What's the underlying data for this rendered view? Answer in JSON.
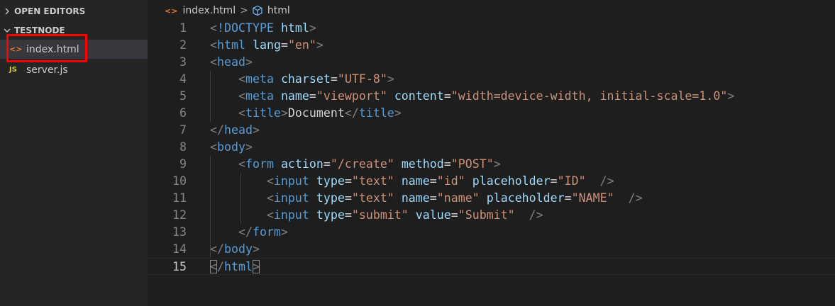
{
  "sidebar": {
    "open_editors_label": "OPEN EDITORS",
    "project_label": "TESTNODE",
    "files": [
      {
        "name": "index.html",
        "icon": "<>",
        "selected": true
      },
      {
        "name": "server.js",
        "icon": "JS",
        "selected": false
      }
    ]
  },
  "breadcrumb": {
    "file": "index.html",
    "separator": ">",
    "symbol": "html"
  },
  "editor": {
    "active_line": 15,
    "lines": [
      {
        "num": "1",
        "tokens": [
          [
            "t-punc",
            "<"
          ],
          [
            "t-tag",
            "!DOCTYPE"
          ],
          [
            "t-text",
            " "
          ],
          [
            "t-attr",
            "html"
          ],
          [
            "t-punc",
            ">"
          ]
        ]
      },
      {
        "num": "2",
        "tokens": [
          [
            "t-punc",
            "<"
          ],
          [
            "t-tag",
            "html"
          ],
          [
            "t-text",
            " "
          ],
          [
            "t-attr",
            "lang"
          ],
          [
            "t-text",
            "="
          ],
          [
            "t-str",
            "\"en\""
          ],
          [
            "t-punc",
            ">"
          ]
        ]
      },
      {
        "num": "3",
        "tokens": [
          [
            "t-punc",
            "<"
          ],
          [
            "t-tag",
            "head"
          ],
          [
            "t-punc",
            ">"
          ]
        ]
      },
      {
        "num": "4",
        "tokens": [
          [
            "t-text",
            "    "
          ],
          [
            "t-punc",
            "<"
          ],
          [
            "t-tag",
            "meta"
          ],
          [
            "t-text",
            " "
          ],
          [
            "t-attr",
            "charset"
          ],
          [
            "t-text",
            "="
          ],
          [
            "t-str",
            "\"UTF-8\""
          ],
          [
            "t-punc",
            ">"
          ]
        ]
      },
      {
        "num": "5",
        "tokens": [
          [
            "t-text",
            "    "
          ],
          [
            "t-punc",
            "<"
          ],
          [
            "t-tag",
            "meta"
          ],
          [
            "t-text",
            " "
          ],
          [
            "t-attr",
            "name"
          ],
          [
            "t-text",
            "="
          ],
          [
            "t-str",
            "\"viewport\""
          ],
          [
            "t-text",
            " "
          ],
          [
            "t-attr",
            "content"
          ],
          [
            "t-text",
            "="
          ],
          [
            "t-str",
            "\"width=device-width, initial-scale=1.0\""
          ],
          [
            "t-punc",
            ">"
          ]
        ]
      },
      {
        "num": "6",
        "tokens": [
          [
            "t-text",
            "    "
          ],
          [
            "t-punc",
            "<"
          ],
          [
            "t-tag",
            "title"
          ],
          [
            "t-punc",
            ">"
          ],
          [
            "t-text",
            "Document"
          ],
          [
            "t-punc",
            "</"
          ],
          [
            "t-tag",
            "title"
          ],
          [
            "t-punc",
            ">"
          ]
        ]
      },
      {
        "num": "7",
        "tokens": [
          [
            "t-punc",
            "</"
          ],
          [
            "t-tag",
            "head"
          ],
          [
            "t-punc",
            ">"
          ]
        ]
      },
      {
        "num": "8",
        "tokens": [
          [
            "t-punc",
            "<"
          ],
          [
            "t-tag",
            "body"
          ],
          [
            "t-punc",
            ">"
          ]
        ]
      },
      {
        "num": "9",
        "tokens": [
          [
            "t-text",
            "    "
          ],
          [
            "t-punc",
            "<"
          ],
          [
            "t-tag",
            "form"
          ],
          [
            "t-text",
            " "
          ],
          [
            "t-attr",
            "action"
          ],
          [
            "t-text",
            "="
          ],
          [
            "t-str",
            "\"/create\""
          ],
          [
            "t-text",
            " "
          ],
          [
            "t-attr",
            "method"
          ],
          [
            "t-text",
            "="
          ],
          [
            "t-str",
            "\"POST\""
          ],
          [
            "t-punc",
            ">"
          ]
        ]
      },
      {
        "num": "10",
        "tokens": [
          [
            "t-text",
            "        "
          ],
          [
            "t-punc",
            "<"
          ],
          [
            "t-tag",
            "input"
          ],
          [
            "t-text",
            " "
          ],
          [
            "t-attr",
            "type"
          ],
          [
            "t-text",
            "="
          ],
          [
            "t-str",
            "\"text\""
          ],
          [
            "t-text",
            " "
          ],
          [
            "t-attr",
            "name"
          ],
          [
            "t-text",
            "="
          ],
          [
            "t-str",
            "\"id\""
          ],
          [
            "t-text",
            " "
          ],
          [
            "t-attr",
            "placeholder"
          ],
          [
            "t-text",
            "="
          ],
          [
            "t-str",
            "\"ID\""
          ],
          [
            "t-text",
            "  "
          ],
          [
            "t-punc",
            "/>"
          ]
        ]
      },
      {
        "num": "11",
        "tokens": [
          [
            "t-text",
            "        "
          ],
          [
            "t-punc",
            "<"
          ],
          [
            "t-tag",
            "input"
          ],
          [
            "t-text",
            " "
          ],
          [
            "t-attr",
            "type"
          ],
          [
            "t-text",
            "="
          ],
          [
            "t-str",
            "\"text\""
          ],
          [
            "t-text",
            " "
          ],
          [
            "t-attr",
            "name"
          ],
          [
            "t-text",
            "="
          ],
          [
            "t-str",
            "\"name\""
          ],
          [
            "t-text",
            " "
          ],
          [
            "t-attr",
            "placeholder"
          ],
          [
            "t-text",
            "="
          ],
          [
            "t-str",
            "\"NAME\""
          ],
          [
            "t-text",
            "  "
          ],
          [
            "t-punc",
            "/>"
          ]
        ]
      },
      {
        "num": "12",
        "tokens": [
          [
            "t-text",
            "        "
          ],
          [
            "t-punc",
            "<"
          ],
          [
            "t-tag",
            "input"
          ],
          [
            "t-text",
            " "
          ],
          [
            "t-attr",
            "type"
          ],
          [
            "t-text",
            "="
          ],
          [
            "t-str",
            "\"submit\""
          ],
          [
            "t-text",
            " "
          ],
          [
            "t-attr",
            "value"
          ],
          [
            "t-text",
            "="
          ],
          [
            "t-str",
            "\"Submit\""
          ],
          [
            "t-text",
            "  "
          ],
          [
            "t-punc",
            "/>"
          ]
        ]
      },
      {
        "num": "13",
        "tokens": [
          [
            "t-text",
            "    "
          ],
          [
            "t-punc",
            "</"
          ],
          [
            "t-tag",
            "form"
          ],
          [
            "t-punc",
            ">"
          ]
        ]
      },
      {
        "num": "14",
        "tokens": [
          [
            "t-punc",
            "</"
          ],
          [
            "t-tag",
            "body"
          ],
          [
            "t-punc",
            ">"
          ]
        ]
      },
      {
        "num": "15",
        "tokens": [
          [
            "t-punc bracket-match",
            "<"
          ],
          [
            "t-punc",
            "/"
          ],
          [
            "t-tag",
            "html"
          ],
          [
            "t-punc bracket-match",
            ">"
          ]
        ]
      }
    ]
  },
  "colors": {
    "editor_bg": "#1e1e1e",
    "sidebar_bg": "#252526",
    "tag": "#569cd6",
    "attribute": "#9cdcfe",
    "string": "#ce9178",
    "highlight_box": "#ff0000"
  }
}
